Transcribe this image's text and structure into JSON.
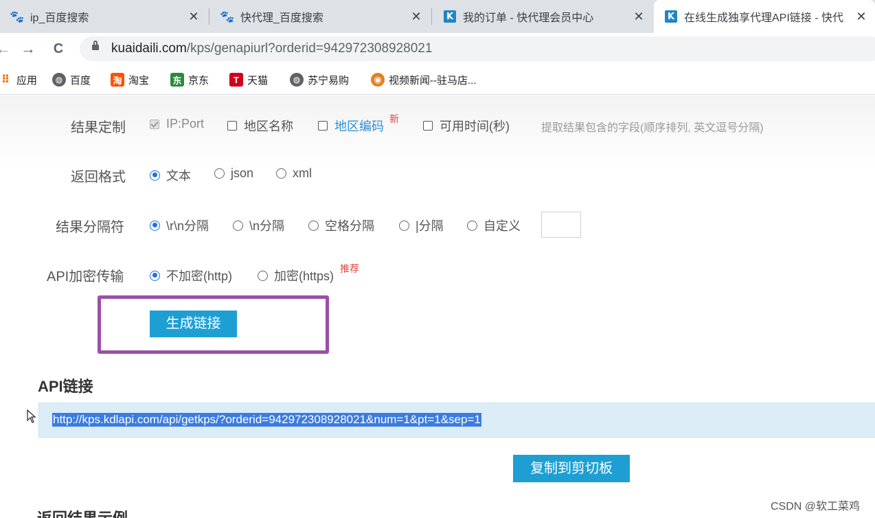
{
  "tabs": [
    {
      "title": "ip_百度搜索",
      "favicon": "baidu-paw-icon",
      "close": "✕"
    },
    {
      "title": "快代理_百度搜索",
      "favicon": "baidu-paw-icon",
      "close": "✕"
    },
    {
      "title": "我的订单 - 快代理会员中心",
      "favicon": "kuaidaili-k-icon",
      "close": "✕"
    },
    {
      "title": "在线生成独享代理API链接 - 快代",
      "favicon": "kuaidaili-k-icon",
      "close": "✕"
    }
  ],
  "nav": {
    "back": "←",
    "forward": "→",
    "reload": "C",
    "url_host": "kuaidaili.com",
    "url_path": "/kps/genapiurl?orderid=942972308928021"
  },
  "bookmarks": [
    {
      "label": "应用",
      "icon": "apps-grid-icon"
    },
    {
      "label": "百度",
      "icon": "globe-icon"
    },
    {
      "label": "淘宝",
      "icon": "taobao-icon",
      "glyph": "淘"
    },
    {
      "label": "京东",
      "icon": "jd-icon",
      "glyph": "东"
    },
    {
      "label": "天猫",
      "icon": "tmall-icon",
      "glyph": "T"
    },
    {
      "label": "苏宁易购",
      "icon": "globe-icon"
    },
    {
      "label": "视频新闻--驻马店...",
      "icon": "video-icon"
    }
  ],
  "form": {
    "result_fields": {
      "label": "结果定制",
      "options": [
        "IP:Port",
        "地区名称",
        "地区编码",
        "可用时间(秒)"
      ],
      "new_badge": "新",
      "hint": "提取结果包含的字段(顺序排列, 英文逗号分隔)"
    },
    "format": {
      "label": "返回格式",
      "options": [
        "文本",
        "json",
        "xml"
      ],
      "selected": "文本"
    },
    "separator": {
      "label": "结果分隔符",
      "options": [
        "\\r\\n分隔",
        "\\n分隔",
        "空格分隔",
        "|分隔",
        "自定义"
      ],
      "selected": "\\r\\n分隔",
      "custom_value": ""
    },
    "encryption": {
      "label": "API加密传输",
      "options": [
        "不加密(http)",
        "加密(https)"
      ],
      "selected": "不加密(http)",
      "recommend_badge": "推荐"
    },
    "generate_button": "生成链接"
  },
  "api": {
    "title": "API链接",
    "url": "http://kps.kdlapi.com/api/getkps/?orderid=942972308928021&num=1&pt=1&sep=1",
    "copy_button": "复制到剪切板"
  },
  "next_section_title": "返回结果示例",
  "watermark": "CSDN @软工菜鸡",
  "colors": {
    "accent_button": "#1e9fd4",
    "highlight_box": "#9b4fa8",
    "link_blue": "#2d8fd5",
    "badge_red": "#e2453c",
    "selection": "#3b7ce0"
  }
}
